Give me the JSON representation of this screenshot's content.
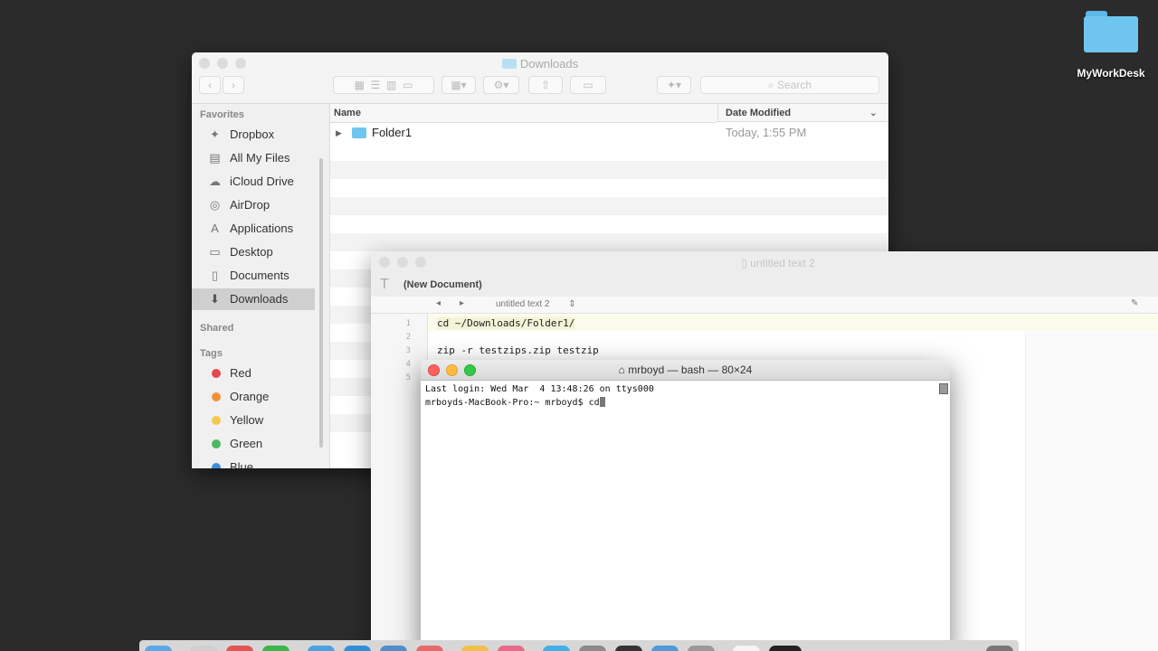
{
  "desktop": {
    "folder_label": "MyWorkDesk"
  },
  "finder": {
    "title": "Downloads",
    "search_placeholder": "Search",
    "sidebar": {
      "favorites_header": "Favorites",
      "favorites": [
        {
          "label": "Dropbox",
          "icon": "dropbox-icon"
        },
        {
          "label": "All My Files",
          "icon": "all-files-icon"
        },
        {
          "label": "iCloud Drive",
          "icon": "cloud-icon"
        },
        {
          "label": "AirDrop",
          "icon": "airdrop-icon"
        },
        {
          "label": "Applications",
          "icon": "applications-icon"
        },
        {
          "label": "Desktop",
          "icon": "desktop-icon"
        },
        {
          "label": "Documents",
          "icon": "documents-icon"
        },
        {
          "label": "Downloads",
          "icon": "downloads-icon",
          "selected": true
        }
      ],
      "shared_header": "Shared",
      "tags_header": "Tags",
      "tags": [
        {
          "label": "Red",
          "color": "#e5484d"
        },
        {
          "label": "Orange",
          "color": "#f0913a"
        },
        {
          "label": "Yellow",
          "color": "#f2c94c"
        },
        {
          "label": "Green",
          "color": "#4cb860"
        },
        {
          "label": "Blue",
          "color": "#3d8fe0"
        }
      ]
    },
    "columns": {
      "name": "Name",
      "date_modified": "Date Modified"
    },
    "files": [
      {
        "name": "Folder1",
        "date": "Today, 1:55 PM"
      }
    ]
  },
  "editor": {
    "window_title": "untitled text 2",
    "toolbar_label": "(New Document)",
    "doc_selector": "untitled text 2",
    "lines": [
      "cd ~/Downloads/Folder1/",
      "",
      "zip -r testzips.zip testzip",
      "",
      ""
    ],
    "line_numbers": [
      "1",
      "2",
      "3",
      "4",
      "5"
    ]
  },
  "terminal": {
    "title": "mrboyd — bash — 80×24",
    "lines": [
      "Last login: Wed Mar  4 13:48:26 on ttys000",
      "mrboyds-MacBook-Pro:~ mrboyd$ cd"
    ]
  }
}
